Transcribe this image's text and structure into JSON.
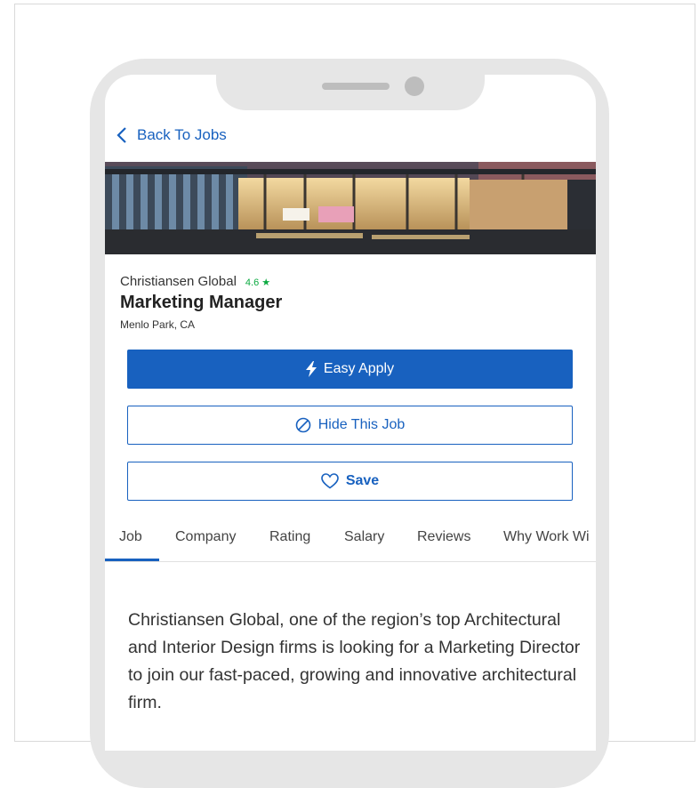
{
  "nav": {
    "back_label": "Back To Jobs"
  },
  "job": {
    "company": "Christiansen Global",
    "rating": "4.6 ★",
    "title": "Marketing Manager",
    "location": "Menlo Park, CA"
  },
  "actions": {
    "easy_apply_label": "Easy Apply",
    "hide_label": "Hide This Job",
    "save_label": "Save"
  },
  "tabs": [
    {
      "label": "Job",
      "active": true
    },
    {
      "label": "Company"
    },
    {
      "label": "Rating"
    },
    {
      "label": "Salary"
    },
    {
      "label": "Reviews"
    },
    {
      "label": "Why Work Wi"
    }
  ],
  "description": "Christiansen Global, one of the region’s top Architectural and Interior Design firms is looking for a Marketing Director to join our fast-paced, growing and innovative architectural firm.",
  "colors": {
    "accent": "#1861bf",
    "rating": "#0caa41"
  }
}
